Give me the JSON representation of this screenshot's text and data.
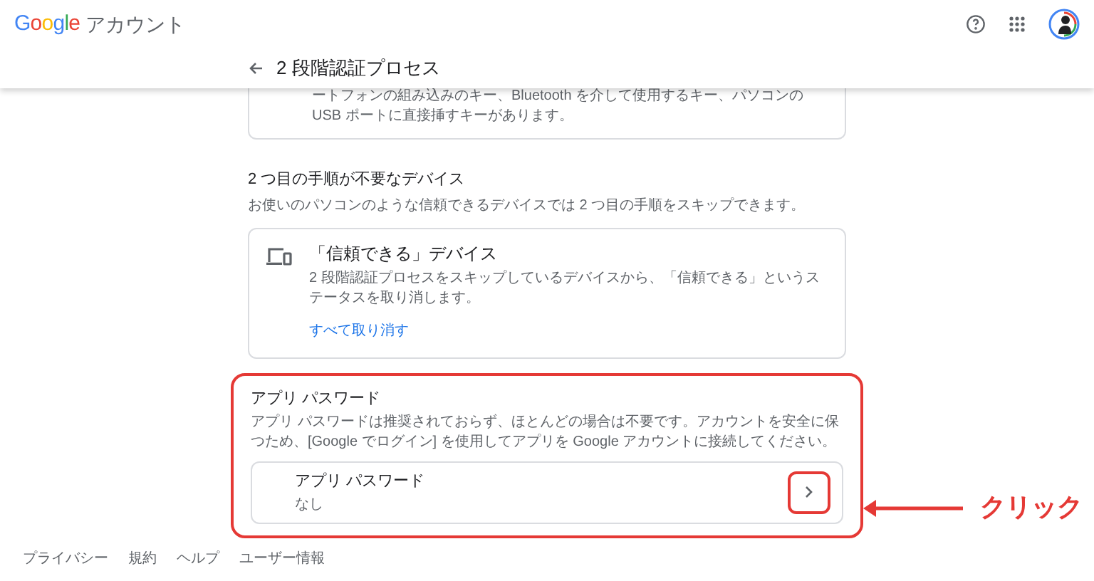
{
  "header": {
    "logo": "Google",
    "product": "アカウント",
    "page_title": "2 段階認証プロセス"
  },
  "security_key_card": {
    "lines": [
      "ートフォンの組み込みのキー、Bluetooth を介して使用するキー、パソコンの",
      "USB ポートに直接挿すキーがあります。"
    ]
  },
  "trusted_devices": {
    "heading": "2 つ目の手順が不要なデバイス",
    "description": "お使いのパソコンのような信頼できるデバイスでは 2 つ目の手順をスキップできます。",
    "card": {
      "title": "「信頼できる」デバイス",
      "description": "2 段階認証プロセスをスキップしているデバイスから、「信頼できる」というステータスを取り消します。",
      "link": "すべて取り消す"
    }
  },
  "app_passwords": {
    "heading": "アプリ パスワード",
    "description": "アプリ パスワードは推奨されておらず、ほとんどの場合は不要です。アカウントを安全に保つため、[Google でログイン] を使用してアプリを Google アカウントに接続してください。",
    "item": {
      "title": "アプリ パスワード",
      "value": "なし"
    },
    "highlighted": true
  },
  "annotation": {
    "label": "クリック"
  },
  "footer": [
    "プライバシー",
    "規約",
    "ヘルプ",
    "ユーザー情報"
  ]
}
